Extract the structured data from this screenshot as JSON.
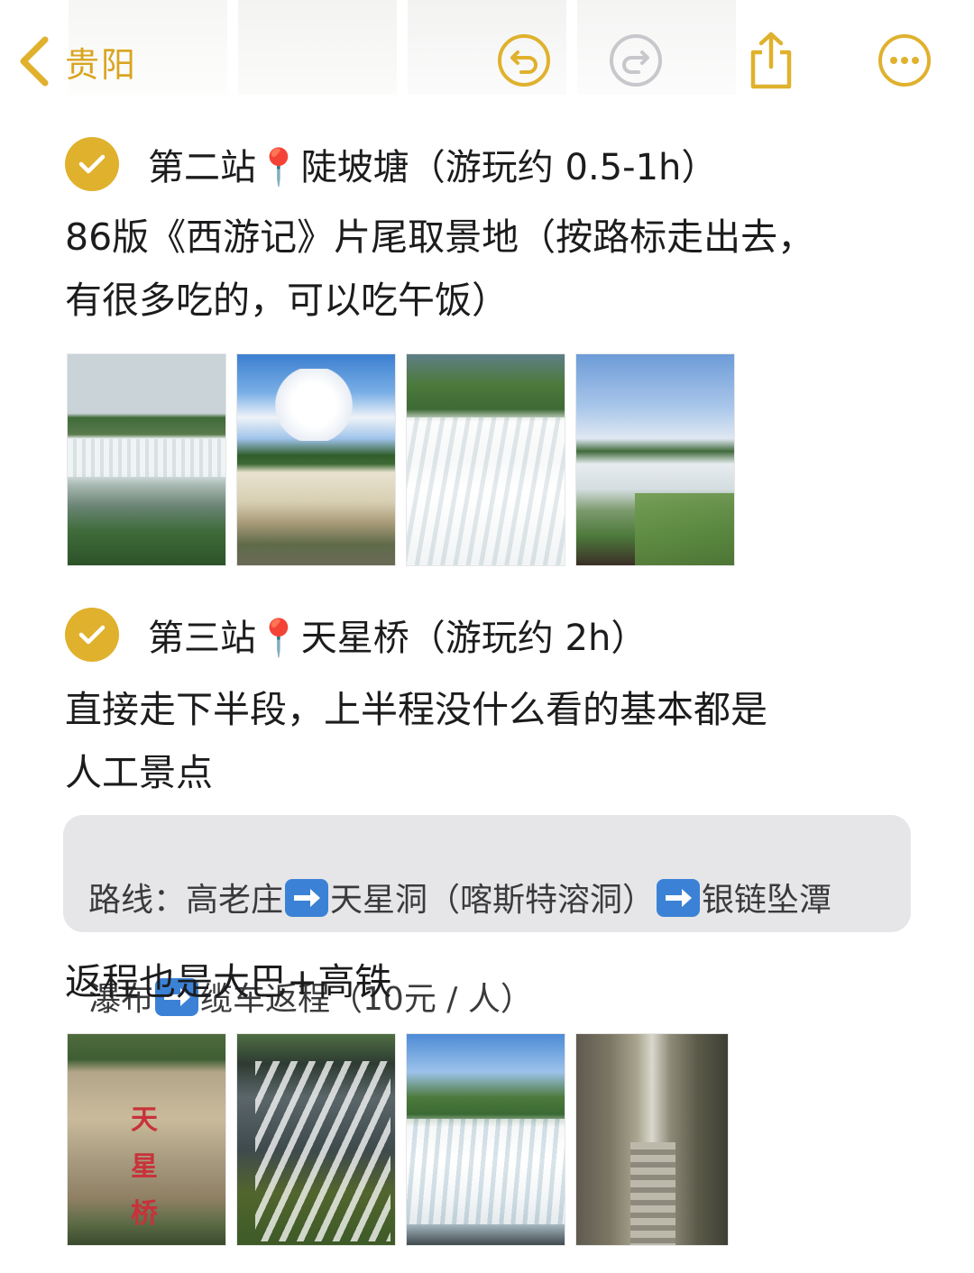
{
  "nav": {
    "back_label": "贵阳",
    "accent_color": "#e0b12d",
    "icons": [
      "chevron-left-icon",
      "undo-icon",
      "redo-icon",
      "share-icon",
      "more-icon"
    ]
  },
  "section2": {
    "title": "第二站📍陡坡塘（游玩约 0.5-1h）",
    "body": "86版《西游记》片尾取景地（按路标走出去，\n有很多吃的，可以吃午饭）"
  },
  "section3": {
    "title": "第三站📍天星桥（游玩约 2h）",
    "body": "直接走下半段，上半程没什么看的基本都是\n人工景点",
    "route": {
      "line1_a": "路线：高老庄",
      "line1_b": "天星洞（喀斯特溶洞）",
      "line1_c": "银链坠潭",
      "line2_a": "瀑布",
      "line2_b": "缆车返程（10元 / 人）"
    },
    "note": "返程也是大巴+高铁"
  },
  "photos_row1": [
    "waterfall-photo-1",
    "waterfall-photo-2",
    "waterfall-photo-3",
    "waterfall-photo-4"
  ],
  "photos_row2": [
    "tianxingqiao-cliff-photo",
    "silver-chain-falls-photo",
    "waterfall-basin-photo",
    "stone-path-photo"
  ],
  "top_sign_text": "天星桥"
}
